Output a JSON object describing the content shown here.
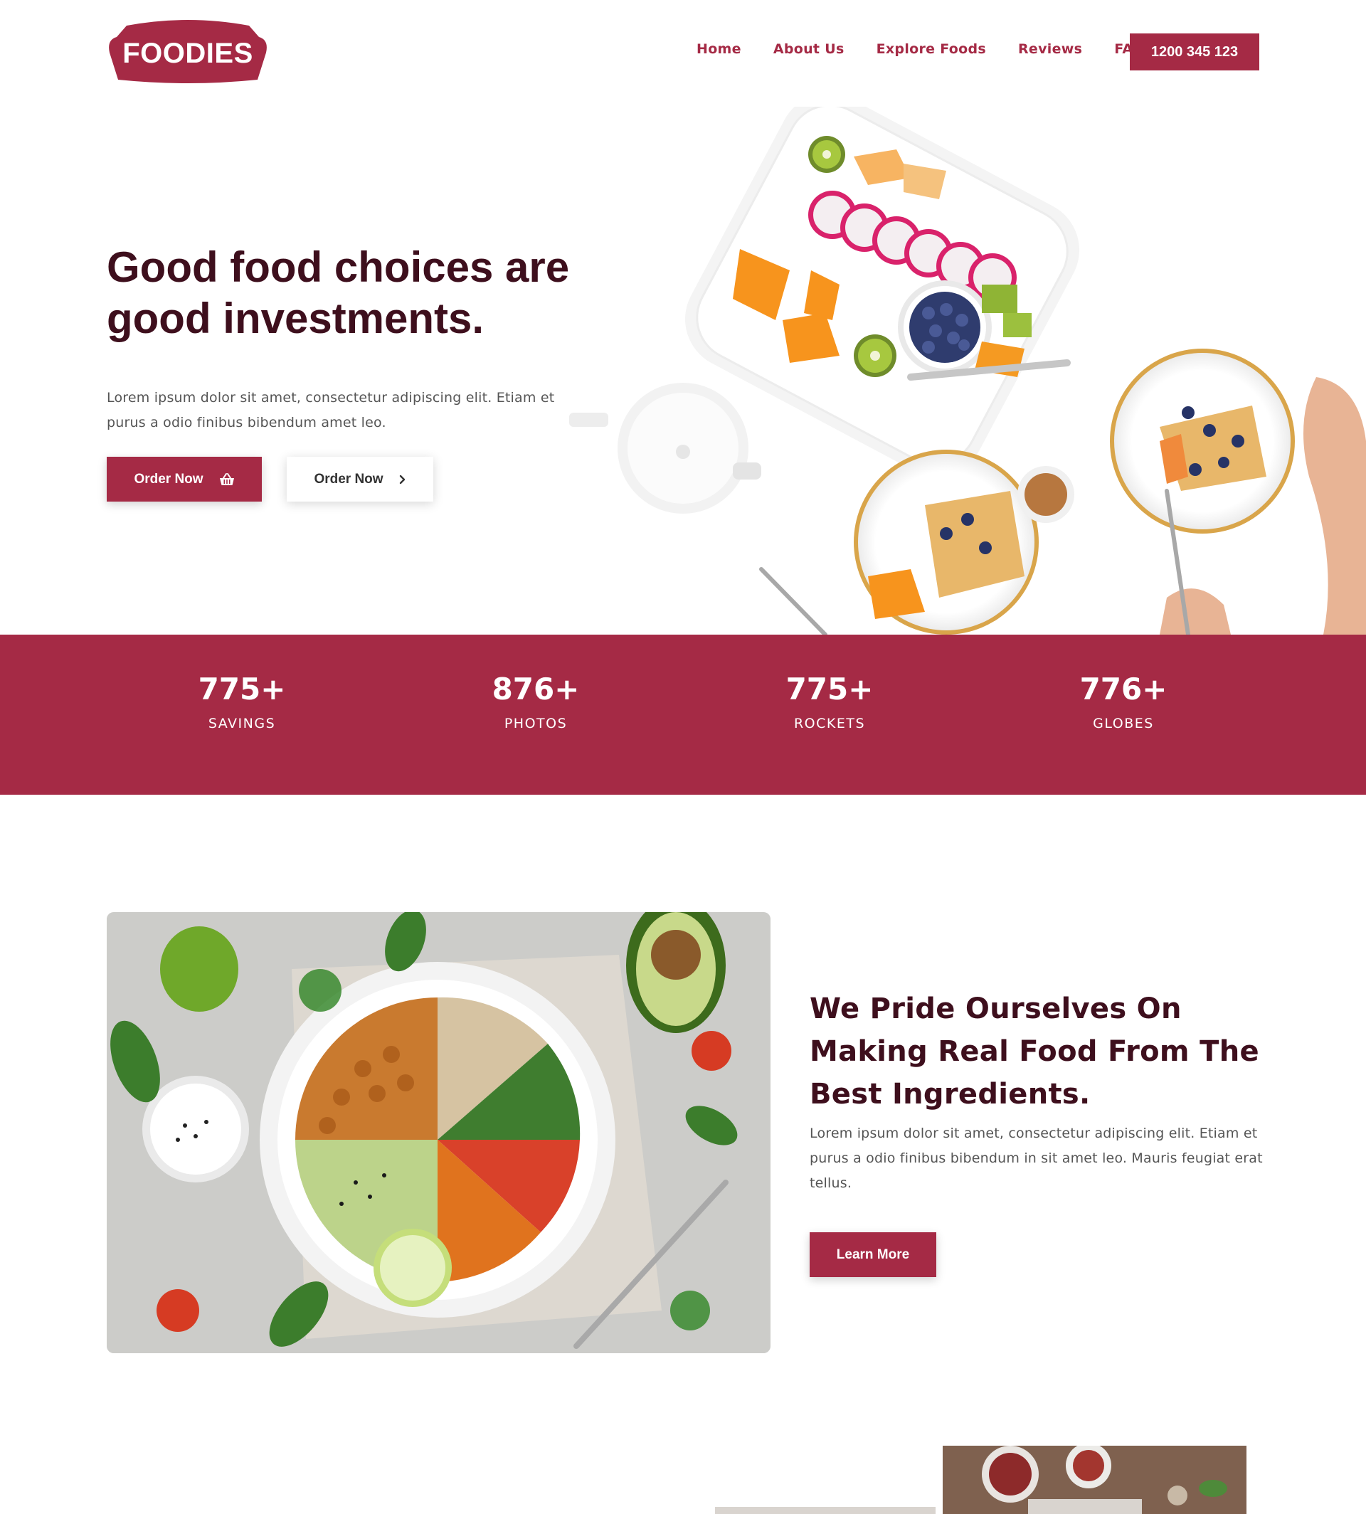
{
  "brand": {
    "logo_text": "FOODIES",
    "primary_color": "#a52a45",
    "dark_color": "#3e0f1d"
  },
  "nav": {
    "items": [
      "Home",
      "About Us",
      "Explore Foods",
      "Reviews",
      "FAQ"
    ],
    "phone": "1200 345 123"
  },
  "hero": {
    "title": "Good food choices are good investments.",
    "text": "Lorem ipsum dolor sit amet, consectetur adipiscing elit. Etiam et purus a odio finibus bibendum amet leo.",
    "primary_button": "Order Now",
    "primary_icon": "basket-icon",
    "secondary_button": "Order Now",
    "secondary_icon": "chevron-right-icon",
    "image": "fruit-plates-breakfast-photo"
  },
  "stats": [
    {
      "value": "775+",
      "label": "SAVINGS"
    },
    {
      "value": "876+",
      "label": "PHOTOS"
    },
    {
      "value": "775+",
      "label": "ROCKETS"
    },
    {
      "value": "776+",
      "label": "GLOBES"
    }
  ],
  "about": {
    "image": "buddha-bowl-photo",
    "title": "We Pride Ourselves On Making Real Food From The Best Ingredients.",
    "text": "Lorem ipsum dolor sit amet, consectetur adipiscing elit. Etiam et purus a odio finibus bibendum in sit amet leo. Mauris feugiat erat tellus.",
    "button": "Learn More"
  },
  "bottom": {
    "image": "jam-jars-photo"
  }
}
